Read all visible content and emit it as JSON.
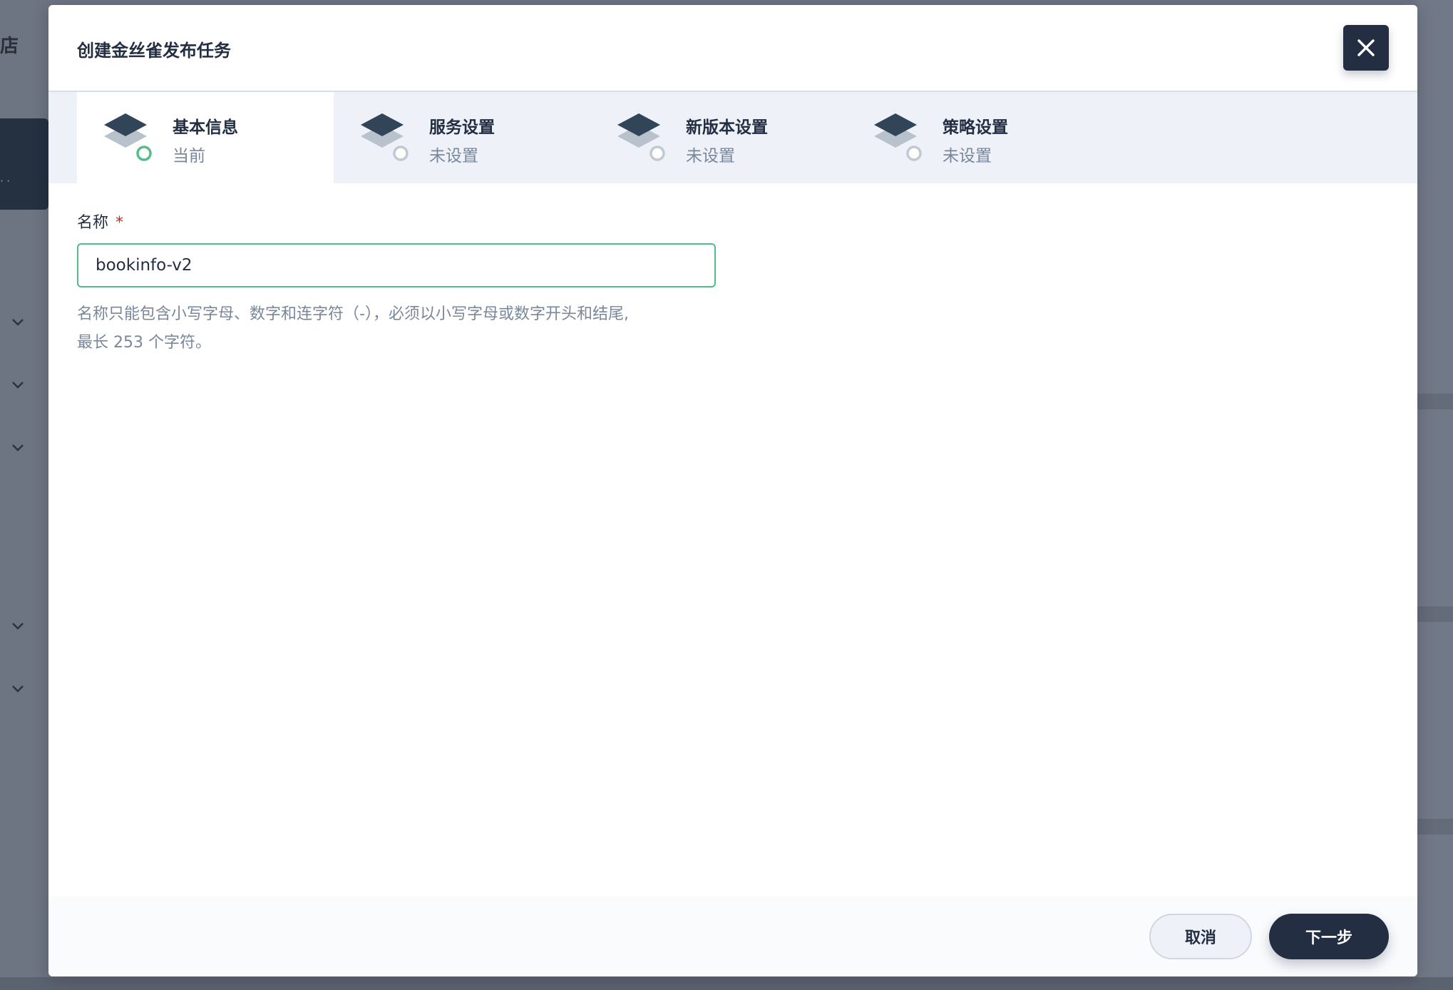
{
  "background": {
    "store_text": "店"
  },
  "modal": {
    "title": "创建金丝雀发布任务"
  },
  "steps": [
    {
      "name": "基本信息",
      "status": "当前",
      "state": "active",
      "ring_color": "#55bc8a"
    },
    {
      "name": "服务设置",
      "status": "未设置",
      "state": "pending",
      "ring_color": "#c1c9d1"
    },
    {
      "name": "新版本设置",
      "status": "未设置",
      "state": "pending",
      "ring_color": "#c1c9d1"
    },
    {
      "name": "策略设置",
      "status": "未设置",
      "state": "pending",
      "ring_color": "#c1c9d1"
    }
  ],
  "form": {
    "name_label": "名称",
    "required_mark": "*",
    "name_value": "bookinfo-v2",
    "hint_line1": "名称只能包含小写字母、数字和连字符（-），必须以小写字母或数字开头和结尾,",
    "hint_line2": "最长 253 个字符。"
  },
  "footer": {
    "cancel_label": "取消",
    "next_label": "下一步"
  },
  "colors": {
    "primary_dark": "#242e42",
    "success_green": "#55bc8a",
    "muted_text": "#79879c",
    "required_red": "#ca2621"
  }
}
